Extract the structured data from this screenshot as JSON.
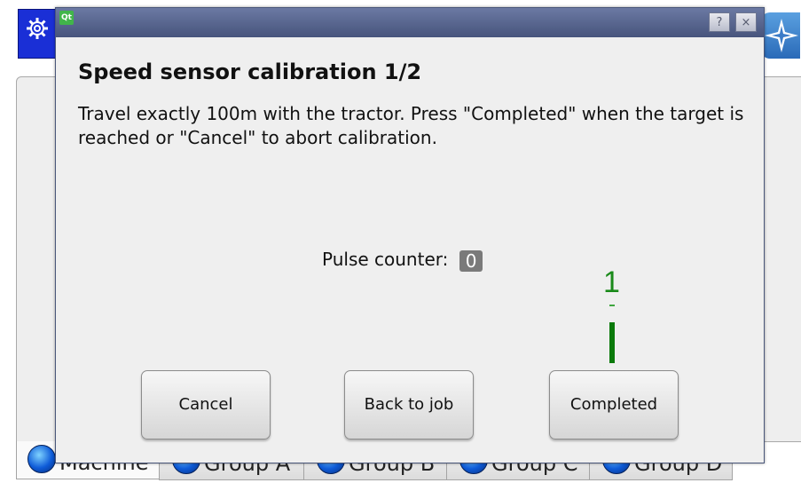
{
  "background": {
    "tabs": [
      {
        "label": "Machine"
      },
      {
        "label": "Group A"
      },
      {
        "label": "Group B"
      },
      {
        "label": "Group C"
      },
      {
        "label": "Group D"
      }
    ]
  },
  "dialog": {
    "titlebar_icon": "Qt",
    "help_label": "?",
    "close_label": "×",
    "title": "Speed sensor calibration 1/2",
    "message": "Travel exactly 100m with the tractor. Press \"Completed\" when the target is reached or \"Cancel\" to abort calibration.",
    "pulse_label": "Pulse counter:",
    "pulse_value": "0",
    "annotation_number": "1",
    "buttons": {
      "cancel": "Cancel",
      "back": "Back to job",
      "completed": "Completed"
    }
  },
  "colors": {
    "titlebar": "#5a6790",
    "app_icon": "#1a2fd6",
    "annotation": "#0b7a0b"
  },
  "icons": [
    "gear-icon",
    "qt-icon",
    "compass-icon",
    "help-icon",
    "close-icon"
  ]
}
